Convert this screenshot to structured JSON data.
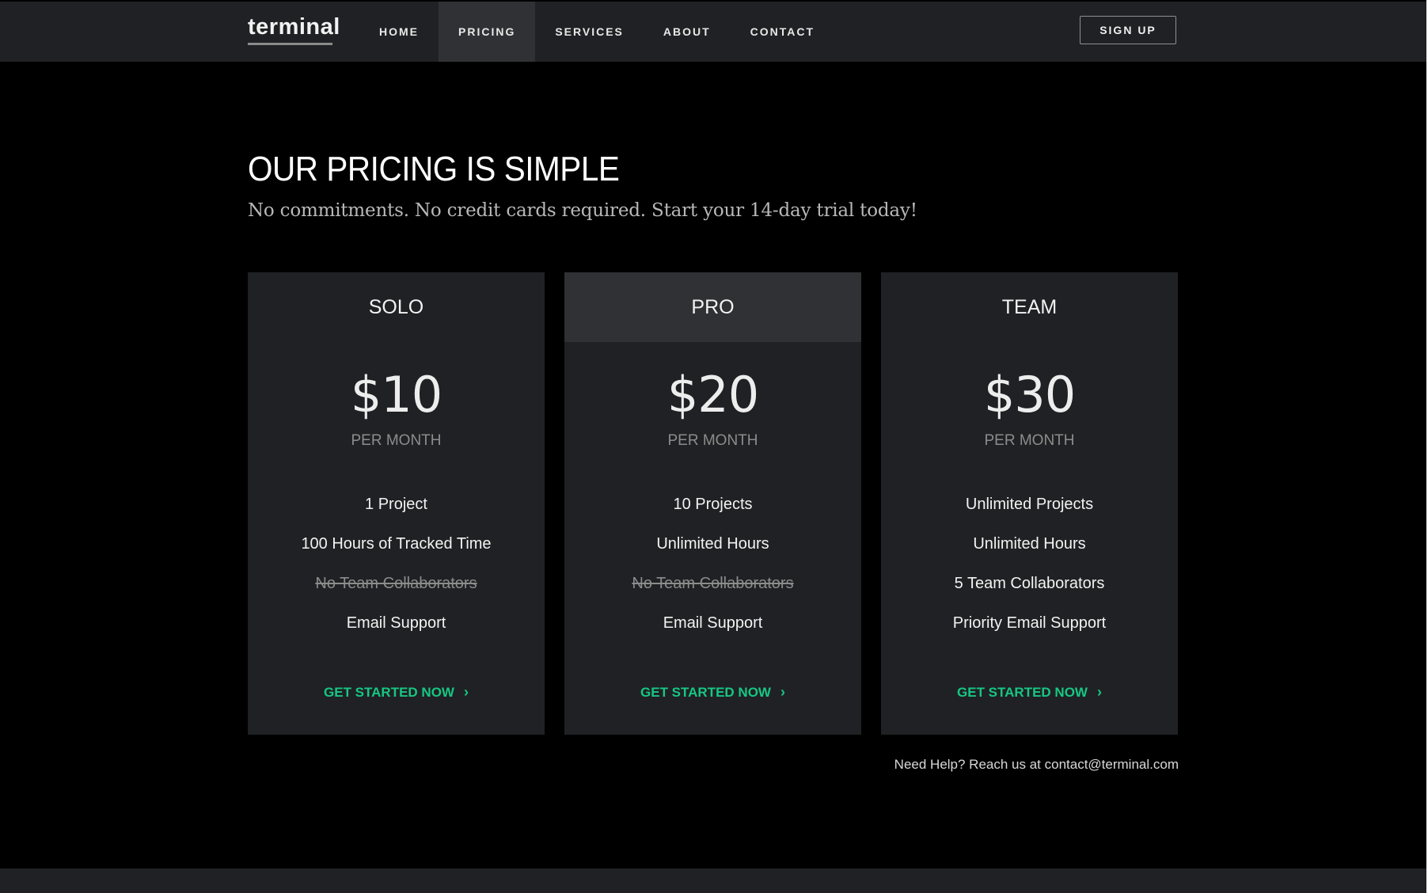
{
  "nav": {
    "logo": "terminal",
    "items": [
      {
        "label": "HOME",
        "active": false
      },
      {
        "label": "PRICING",
        "active": true
      },
      {
        "label": "SERVICES",
        "active": false
      },
      {
        "label": "ABOUT",
        "active": false
      },
      {
        "label": "CONTACT",
        "active": false
      }
    ],
    "signup": "SIGN UP"
  },
  "header": {
    "title": "OUR PRICING IS SIMPLE",
    "subtitle": "No commitments. No credit cards required. Start your 14-day trial today!"
  },
  "plans": [
    {
      "name": "SOLO",
      "price": "$10",
      "period": "PER MONTH",
      "features": [
        "1 Project",
        "100 Hours of Tracked Time",
        "No Team Collaborators",
        "Email Support"
      ],
      "cta": "GET STARTED NOW"
    },
    {
      "name": "PRO",
      "price": "$20",
      "period": "PER MONTH",
      "features": [
        "10 Projects",
        "Unlimited Hours",
        "No Team Collaborators",
        "Email Support"
      ],
      "cta": "GET STARTED NOW"
    },
    {
      "name": "TEAM",
      "price": "$30",
      "period": "PER MONTH",
      "features": [
        "Unlimited Projects",
        "Unlimited Hours",
        "5 Team Collaborators",
        "Priority Email Support"
      ],
      "cta": "GET STARTED NOW"
    }
  ],
  "help": "Need Help? Reach us at contact@terminal.com",
  "colors": {
    "accent": "#16c784",
    "background": "#000000",
    "card": "#202124",
    "card_featured_head": "#303134",
    "nav": "#202124"
  },
  "icons": {
    "cta_arrow": "chevron-right-icon"
  }
}
